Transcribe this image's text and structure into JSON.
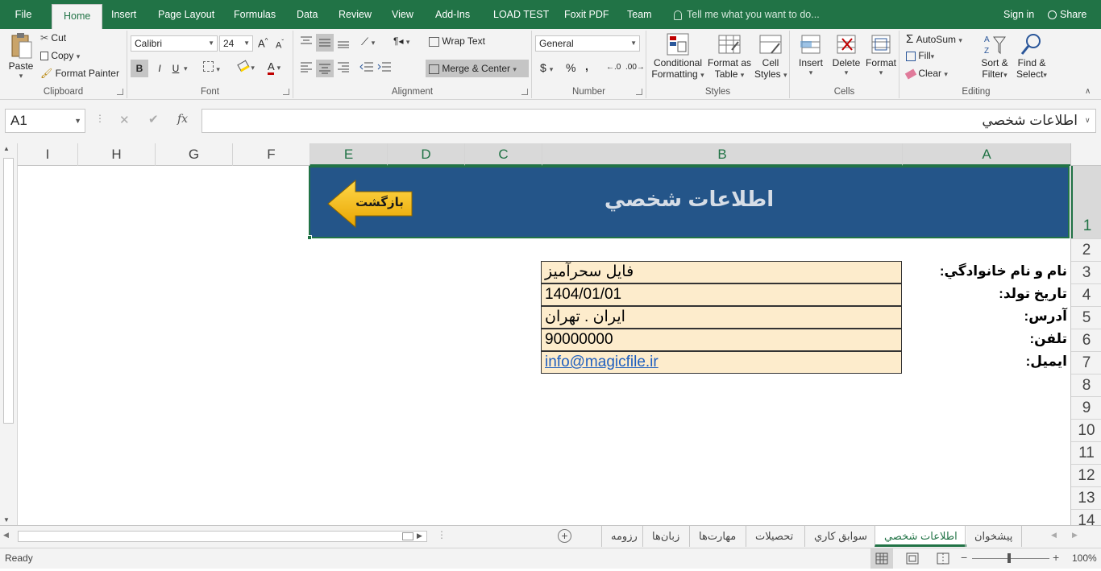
{
  "ribbon_tabs": [
    "File",
    "Home",
    "Insert",
    "Page Layout",
    "Formulas",
    "Data",
    "Review",
    "View",
    "Add-Ins",
    "LOAD TEST",
    "Foxit PDF",
    "Team"
  ],
  "tell_me": "Tell me what you want to do...",
  "sign_in": "Sign in",
  "share": "Share",
  "clipboard": {
    "paste": "Paste",
    "cut": "Cut",
    "copy": "Copy",
    "format_painter": "Format Painter",
    "label": "Clipboard"
  },
  "font": {
    "name": "Calibri",
    "size": "24",
    "bold": "B",
    "italic": "I",
    "underline": "U",
    "label": "Font"
  },
  "alignment": {
    "wrap": "Wrap Text",
    "merge": "Merge & Center",
    "label": "Alignment"
  },
  "number": {
    "format": "General",
    "currency": "$",
    "percent": "%",
    "comma": ",",
    "label": "Number"
  },
  "styles": {
    "conditional": "Conditional",
    "conditional2": "Formatting",
    "format_table": "Format as",
    "format_table2": "Table",
    "cell_styles": "Cell",
    "cell_styles2": "Styles",
    "label": "Styles"
  },
  "cells": {
    "insert": "Insert",
    "delete": "Delete",
    "format": "Format",
    "label": "Cells"
  },
  "editing": {
    "autosum": "AutoSum",
    "fill": "Fill",
    "clear": "Clear",
    "sort": "Sort &",
    "sort2": "Filter",
    "find": "Find &",
    "find2": "Select",
    "label": "Editing"
  },
  "formula_bar": {
    "name_box": "A1",
    "fx": "fx",
    "content": "اطلاعات شخصي"
  },
  "columns": [
    "I",
    "H",
    "G",
    "F",
    "E",
    "D",
    "C",
    "B",
    "A"
  ],
  "rows": [
    "1",
    "2",
    "3",
    "4",
    "5",
    "6",
    "7",
    "8",
    "9",
    "10",
    "11",
    "12",
    "13",
    "14"
  ],
  "banner": {
    "title": "اطلاعات شخصي",
    "back": "بازگشت"
  },
  "fields": [
    {
      "label": "نام و نام خانوادگي:",
      "value": "فایل سحرآمیز"
    },
    {
      "label": "تاريخ تولد:",
      "value": "1404/01/01"
    },
    {
      "label": "آدرس:",
      "value": "ایران . تهران"
    },
    {
      "label": "تلفن:",
      "value": "90000000"
    },
    {
      "label": "ايميل:",
      "value": "info@magicfile.ir"
    }
  ],
  "sheet_tabs": [
    "پیشخوان",
    "اطلاعات شخصي",
    "سوابق کاري",
    "تحصيلات",
    "مهارت‌ها",
    "زبان‌ها",
    "رزومه"
  ],
  "active_sheet": "اطلاعات شخصي",
  "status": {
    "ready": "Ready",
    "zoom": "100%"
  },
  "colors": {
    "accent": "#217346",
    "banner": "#245589",
    "value_fill": "#fdeccc",
    "arrow": "#f5b800"
  }
}
